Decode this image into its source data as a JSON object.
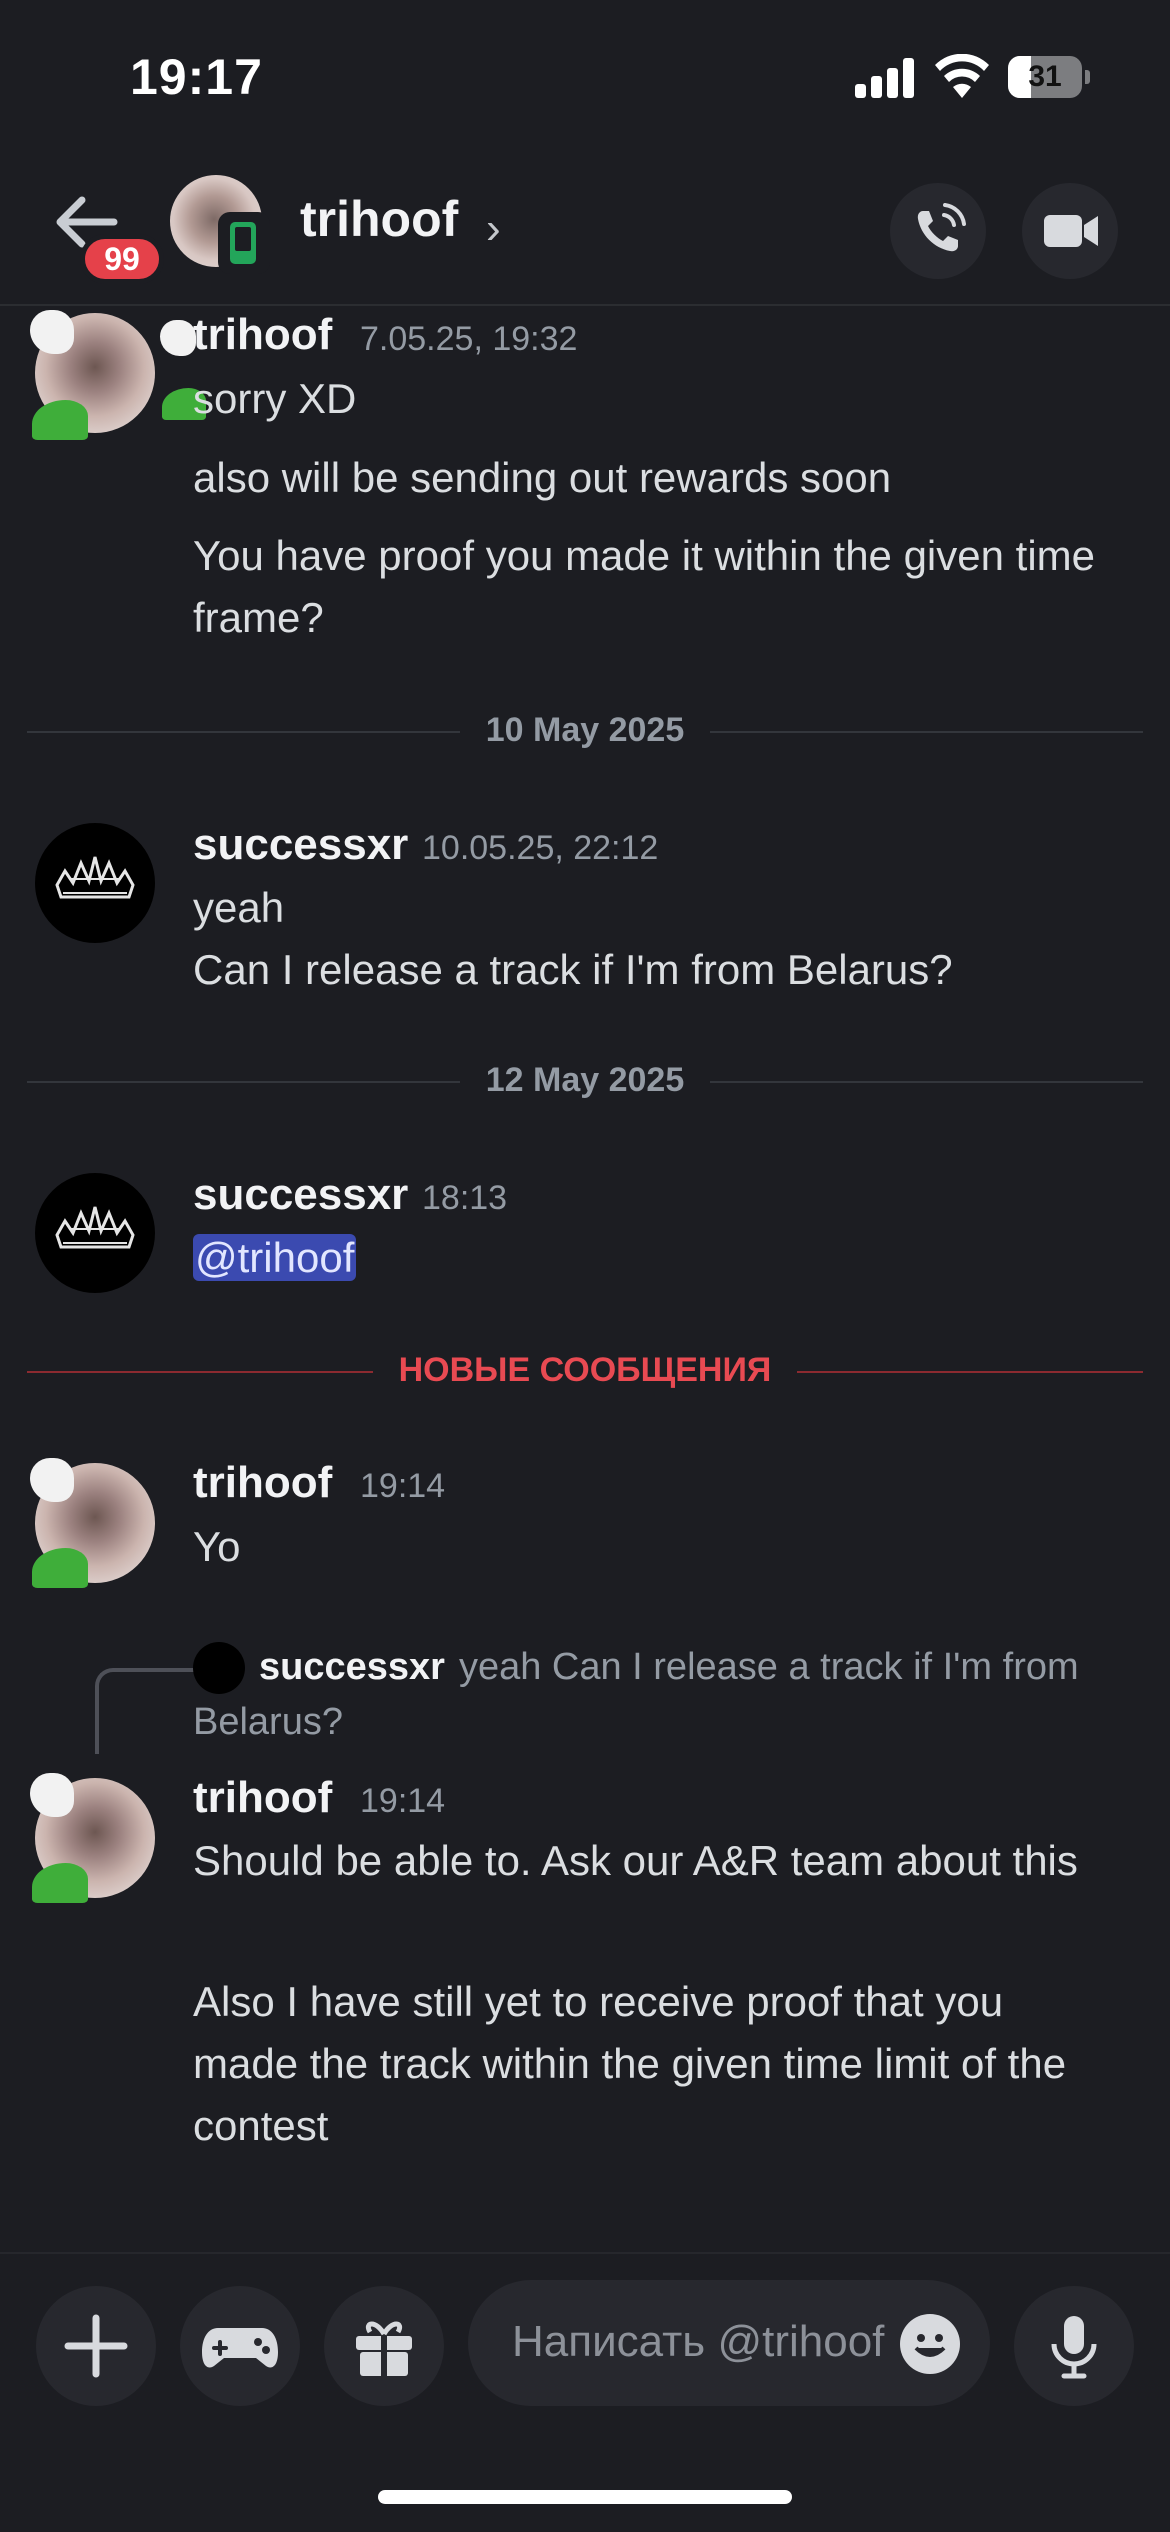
{
  "status_bar": {
    "time": "19:17",
    "battery": "31",
    "battery_level": 0.31
  },
  "header": {
    "unread_count": "99",
    "username": "trihoof",
    "chevron": "›"
  },
  "messages": [
    {
      "author": "trihoof",
      "time": "7.05.25, 19:32",
      "lines": [
        "sorry XD",
        "also will be sending out rewards soon",
        "You have proof you made it within the given time frame?"
      ]
    },
    {
      "author": "successxr",
      "time": "10.05.25, 22:12",
      "lines": [
        "yeah",
        "Can I release a track if I'm from Belarus?"
      ]
    },
    {
      "author": "successxr",
      "time": "18:13",
      "lines": [
        "@trihoof"
      ]
    },
    {
      "author": "trihoof",
      "time": "19:14",
      "lines": [
        "Yo"
      ]
    },
    {
      "author": "trihoof",
      "time": "19:14",
      "lines": [
        "Should be able to. Ask our A&R team about this",
        "Also I have still yet to receive proof that you made the track within the given time limit of the contest"
      ]
    }
  ],
  "dividers": {
    "date_1": "10 May 2025",
    "date_2": "12 May 2025",
    "new_messages": "НОВЫЕ СООБЩЕНИЯ"
  },
  "reply": {
    "author": "successxr",
    "text": "yeah Can I release a track if I'm from Belarus?"
  },
  "composer": {
    "placeholder": "Написать @trihoof"
  },
  "colors": {
    "background": "#1c1d22",
    "mention": "#3b4ab0",
    "new_divider": "#e84a52",
    "badge": "#e5414a",
    "online_mobile": "#23a55a"
  },
  "icons": [
    "back-arrow-icon",
    "mobile-phone-icon",
    "chevron-right-icon",
    "phone-call-icon",
    "video-camera-icon",
    "plus-icon",
    "gamepad-icon",
    "gift-icon",
    "emoji-icon",
    "microphone-icon"
  ]
}
